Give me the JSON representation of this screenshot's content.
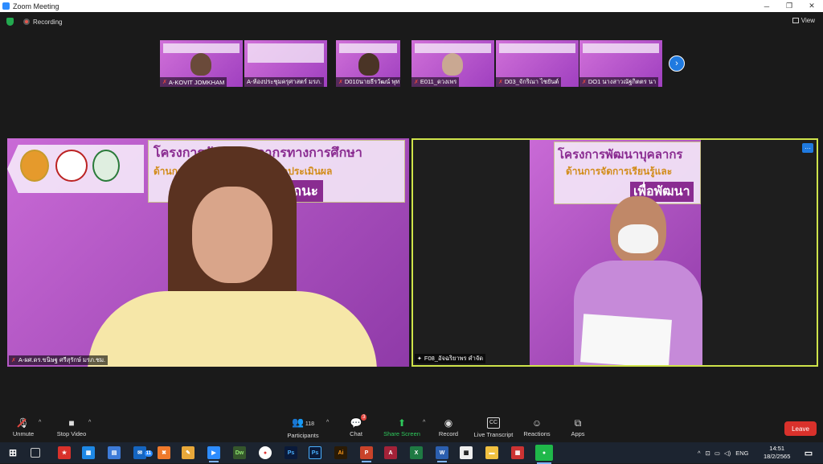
{
  "window": {
    "title": "Zoom Meeting",
    "minimize": "─",
    "restore": "❐",
    "close": "✕"
  },
  "status": {
    "recording": "Recording",
    "view": "View"
  },
  "thumbnails": [
    {
      "name": "A-KOVIT JOMKHAM",
      "muted": true
    },
    {
      "name": "A-ห้องประชุมครุศาสตร์ มรภ.",
      "muted": false
    },
    {
      "name": "D010นายธีรวัฒน์ พุทธิสิ",
      "muted": true
    },
    {
      "name": "E011_ดวงเพร",
      "muted": true
    },
    {
      "name": "D03_จักริณา ไชยันต์",
      "muted": true
    },
    {
      "name": "DO1 นางสาวณัฐกิตตร นา",
      "muted": true
    }
  ],
  "main_left": {
    "name": "A-ผศ.ดร.ขนิษฐ ศรีสุรักษ์ มรภ.ชม.",
    "slide_title": "โครงการพัฒนาบุคลากรทางการศึกษา",
    "slide_sub": "ด้านการจัดการเรียนรู้และการวัดประเมินผล",
    "slide_sub2": "เพื่อพัฒนาสมรรถนะ"
  },
  "main_right": {
    "name": "F08_อัจฉริยาพร คำจัด",
    "slide_title": "โครงการพัฒนาบุคลากร",
    "slide_sub": "ด้านการจัดการเรียนรู้และ",
    "slide_sub2": "เพื่อพัฒนา",
    "menu": "···"
  },
  "toolbar": {
    "unmute": "Unmute",
    "stop_video": "Stop Video",
    "participants": "Participants",
    "participants_count": "118",
    "chat": "Chat",
    "chat_badge": "3",
    "share_screen": "Share Screen",
    "record": "Record",
    "live_transcript": "Live Transcript",
    "reactions": "Reactions",
    "apps": "Apps",
    "leave": "Leave"
  },
  "taskbar": {
    "language": "ENG",
    "time": "14:51",
    "date": "18/2/2565",
    "mail_badge": "11",
    "apps": [
      "Dw",
      "Ps",
      "Ps",
      "Ai",
      "P",
      "A",
      "X",
      "W"
    ]
  },
  "colors": {
    "zoom_blue": "#2d8cff",
    "leave_red": "#d9312b",
    "active_border": "#cfe34a",
    "share_green": "#2ec95c"
  }
}
